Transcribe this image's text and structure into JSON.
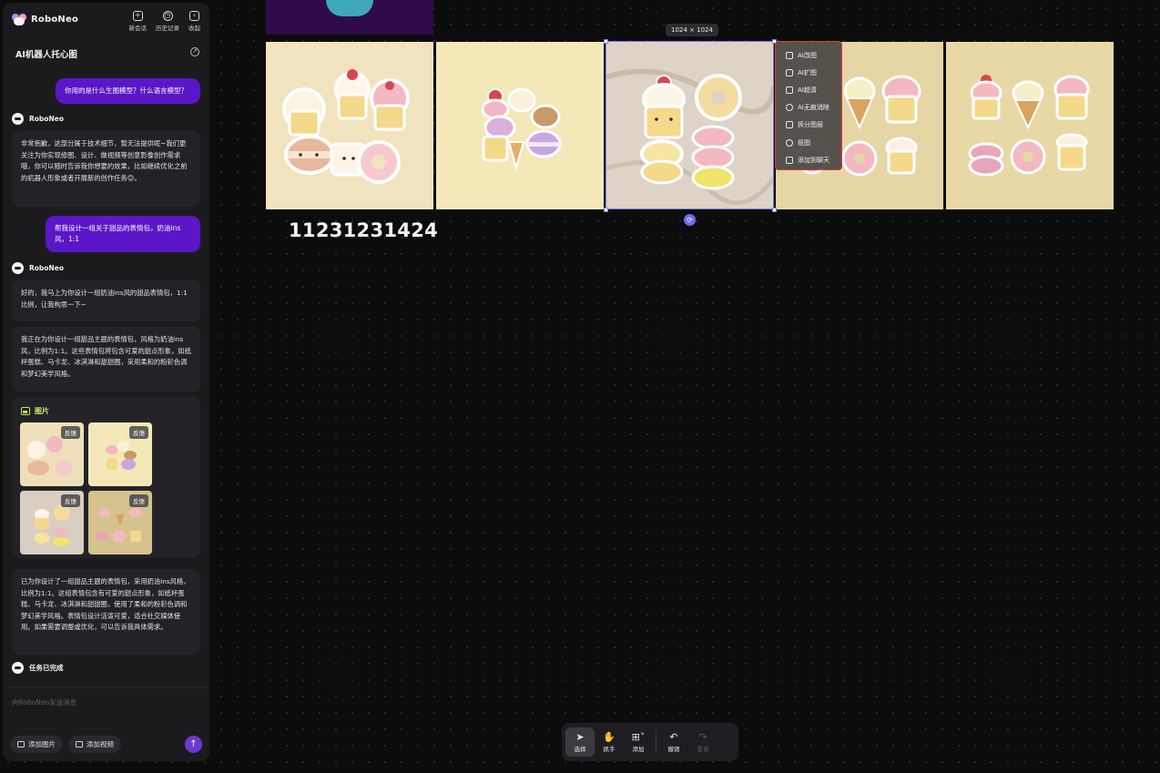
{
  "app": {
    "brand": "RoboNeo"
  },
  "sidebar": {
    "actions": [
      {
        "label": "新会话",
        "icon": "new-chat-icon"
      },
      {
        "label": "历史记录",
        "icon": "history-icon"
      },
      {
        "label": "收起",
        "icon": "collapse-icon"
      }
    ],
    "title": "AI机器人托心图",
    "messages": {
      "user1": "你用的是什么生图模型？什么语言模型？",
      "bot_name": "RoboNeo",
      "bot1": "非常抱歉，这部分属于技术细节，暂无法提供呢~我们更关注为你实现修图、设计、做视频等创意影像创作需求哦，你可以随时告诉我你想要的效果，比如继续优化之前的机器人形象或者开展新的创作任务😊。",
      "user2": "帮我设计一组关于甜品的表情包，奶油ins风，1:1",
      "bot2": "好的，我马上为你设计一组奶油ins风的甜品表情包，1:1比例，让我构思一下~",
      "bot3": "我正在为你设计一组甜品主题的表情包，风格为奶油ins风，比例为1:1。这些表情包将包含可爱的甜点形象，如纸杯蛋糕、马卡龙、冰淇淋和甜甜圈，采用柔和的粉彩色调和梦幻美学风格。",
      "images_title": "图片",
      "thumb_badge": "反馈",
      "bot4": "已为你设计了一组甜品主题的表情包，采用奶油ins风格，比例为1:1。这组表情包含有可爱的甜点形象，如纸杯蛋糕、马卡龙、冰淇淋和甜甜圈，使用了柔和的粉彩色调和梦幻美学风格。表情包设计活泼可爱，适合社交媒体使用。如果需要调整或优化，可以告诉我具体需求。",
      "done": "任务已完成"
    },
    "composer": {
      "placeholder": "向RoboNeo发送消息",
      "add_image": "添加图片",
      "add_video": "添加视频"
    }
  },
  "canvas": {
    "size_label": "1024 × 1024",
    "text_layer": "11231231424"
  },
  "context_menu": {
    "items": [
      {
        "label": "AI改图",
        "icon": "edit-image-icon"
      },
      {
        "label": "AI扩图",
        "icon": "expand-image-icon"
      },
      {
        "label": "AI超清",
        "icon": "hd-icon"
      },
      {
        "label": "AI无痕消除",
        "icon": "eraser-icon"
      },
      {
        "label": "拆分图层",
        "icon": "layers-icon"
      },
      {
        "label": "抠图",
        "icon": "cutout-icon"
      },
      {
        "label": "添加到聊天",
        "icon": "add-to-chat-icon"
      }
    ]
  },
  "toolbar": {
    "select": "选择",
    "hand": "抓手",
    "add": "添加",
    "undo": "撤销",
    "redo": "重做"
  },
  "colors": {
    "accent": "#5b16c8",
    "selection": "#7a7cf0",
    "highlight_box": "#e03a2e",
    "image_label": "#c8f06a"
  }
}
